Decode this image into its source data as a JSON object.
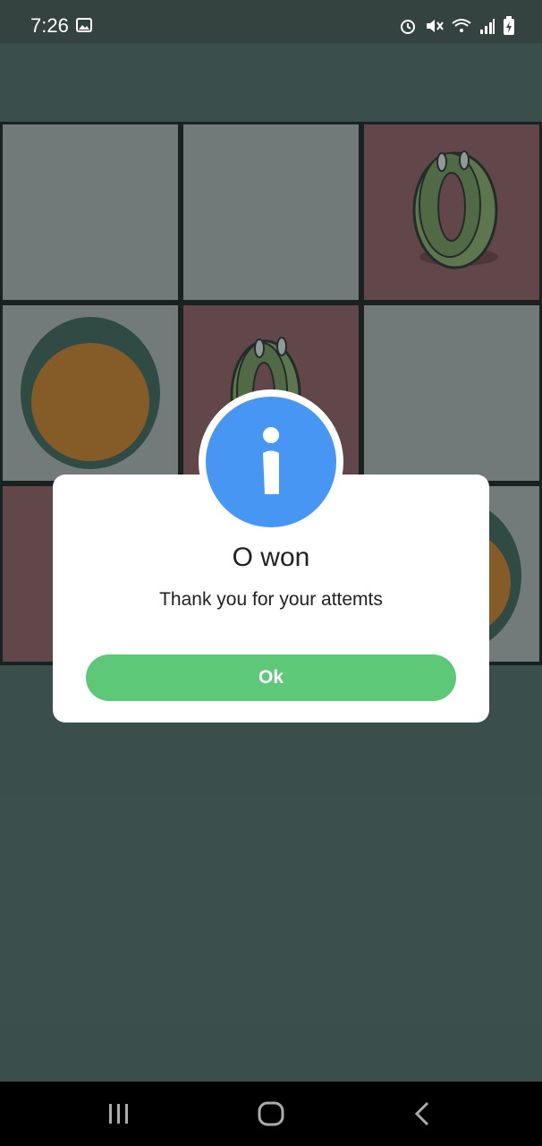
{
  "status_bar": {
    "time": "7:26",
    "icons": [
      "image-icon",
      "alarm-icon",
      "mute-icon",
      "wifi-icon",
      "signal-icon",
      "battery-charging-icon"
    ]
  },
  "board": {
    "rows": 3,
    "cols": 3,
    "cells": [
      "empty",
      "empty",
      "O",
      "X",
      "O",
      "empty",
      "O",
      "empty",
      "X"
    ],
    "colors": {
      "o_cell": "#8a4f57",
      "x_cell": "#a9a9a9",
      "empty_cell": "#a7a7a7",
      "grid": "#111111"
    }
  },
  "dialog": {
    "icon": "info-icon",
    "title": "O won",
    "message": "Thank you for your attemts",
    "ok_label": "Ok",
    "colors": {
      "icon_bg": "#4896f4",
      "ok_bg": "#5cc878"
    }
  },
  "nav_bar": {
    "buttons": [
      "recent-apps-icon",
      "home-icon",
      "back-icon"
    ]
  },
  "colors": {
    "background": "#485e5a",
    "status_bar": "#34433f"
  }
}
